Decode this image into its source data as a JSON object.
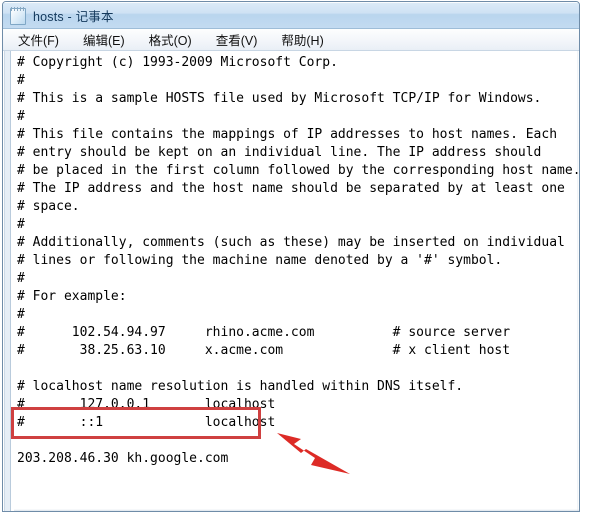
{
  "window": {
    "title": "hosts - 记事本",
    "icon": "notepad-icon"
  },
  "menu": {
    "items": [
      {
        "label": "文件(F)",
        "name": "menu-file"
      },
      {
        "label": "编辑(E)",
        "name": "menu-edit"
      },
      {
        "label": "格式(O)",
        "name": "menu-format"
      },
      {
        "label": "查看(V)",
        "name": "menu-view"
      },
      {
        "label": "帮助(H)",
        "name": "menu-help"
      }
    ]
  },
  "editor": {
    "text": "# Copyright (c) 1993-2009 Microsoft Corp.\n#\n# This is a sample HOSTS file used by Microsoft TCP/IP for Windows.\n#\n# This file contains the mappings of IP addresses to host names. Each\n# entry should be kept on an individual line. The IP address should\n# be placed in the first column followed by the corresponding host name.\n# The IP address and the host name should be separated by at least one\n# space.\n#\n# Additionally, comments (such as these) may be inserted on individual\n# lines or following the machine name denoted by a '#' symbol.\n#\n# For example:\n#\n#      102.54.94.97     rhino.acme.com          # source server\n#       38.25.63.10     x.acme.com              # x client host\n\n# localhost name resolution is handled within DNS itself.\n#       127.0.0.1       localhost\n#       ::1             localhost\n\n203.208.46.30 kh.google.com",
    "lines": [
      "# Copyright (c) 1993-2009 Microsoft Corp.",
      "#",
      "# This is a sample HOSTS file used by Microsoft TCP/IP for Windows.",
      "#",
      "# This file contains the mappings of IP addresses to host names. Each",
      "# entry should be kept on an individual line. The IP address should",
      "# be placed in the first column followed by the corresponding host name.",
      "# The IP address and the host name should be separated by at least one",
      "# space.",
      "#",
      "# Additionally, comments (such as these) may be inserted on individual",
      "# lines or following the machine name denoted by a '#' symbol.",
      "#",
      "# For example:",
      "#",
      "#      102.54.94.97     rhino.acme.com          # source server",
      "#       38.25.63.10     x.acme.com              # x client host",
      "",
      "# localhost name resolution is handled within DNS itself.",
      "#       127.0.0.1       localhost",
      "#       ::1             localhost",
      "",
      "203.208.46.30 kh.google.com"
    ],
    "highlighted_line": "203.208.46.30 kh.google.com"
  },
  "annotations": {
    "highlight_box": {
      "name": "red-highlight-box",
      "color": "#cf4040",
      "target_text": "203.208.46.30 kh.google.com"
    },
    "arrow": {
      "name": "red-arrow-annotation",
      "color": "#dd2b26",
      "direction": "up-left"
    }
  },
  "colors": {
    "title_bar": "#c3dbf1",
    "title_text": "#14395c",
    "menu_bg": "#f3f6fa",
    "text_bg": "#ffffff",
    "text_fg": "#000000",
    "annotation_red": "#cf4040",
    "arrow_red": "#dd2b26",
    "window_border": "#6f8ca8"
  }
}
